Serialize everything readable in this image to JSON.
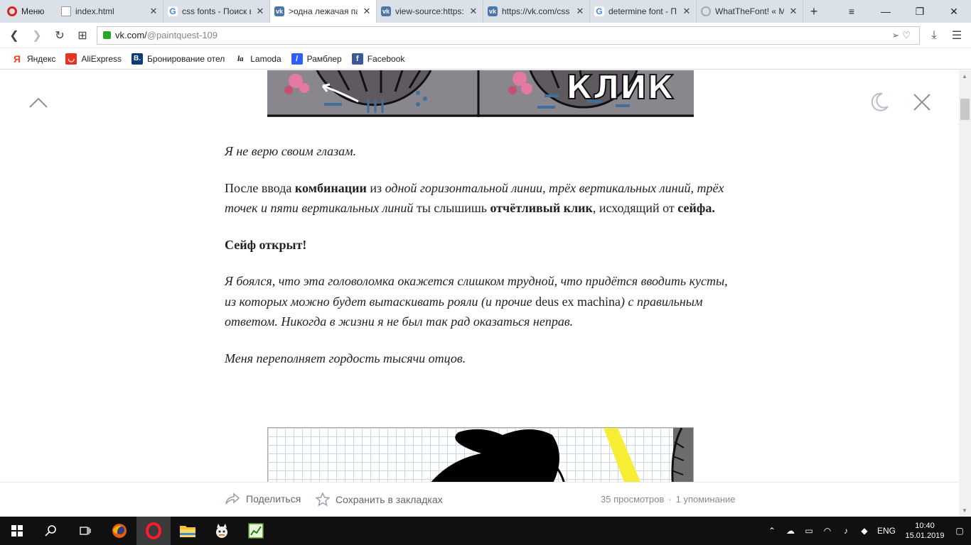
{
  "browser": {
    "menu_label": "Меню",
    "tabs": [
      {
        "title": "index.html",
        "icon": "document-icon"
      },
      {
        "title": "css fonts - Поиск в",
        "icon": "google-icon"
      },
      {
        "title": ">одна лежачая па",
        "icon": "vk-icon",
        "active": true
      },
      {
        "title": "view-source:https:/",
        "icon": "vk-icon"
      },
      {
        "title": "https://vk.com/css",
        "icon": "vk-icon"
      },
      {
        "title": "determine font - П",
        "icon": "google-icon"
      },
      {
        "title": "WhatTheFont! « M",
        "icon": "loading-icon"
      }
    ],
    "new_tab_label": "+",
    "url_host": "vk.com/",
    "url_path": "@paintquest-109",
    "bookmarks": [
      {
        "label": "Яндекс",
        "icon": "yandex-icon",
        "color": "#fc3f1d",
        "glyph": "Я"
      },
      {
        "label": "AliExpress",
        "icon": "aliexpress-icon",
        "color": "#e43225",
        "glyph": "◡"
      },
      {
        "label": "Бронирование отел",
        "icon": "booking-icon",
        "color": "#0c3b7c",
        "glyph": "B."
      },
      {
        "label": "Lamoda",
        "icon": "lamoda-icon",
        "color": "#111111",
        "glyph": "la"
      },
      {
        "label": "Рамблер",
        "icon": "rambler-icon",
        "color": "#315efb",
        "glyph": "/"
      },
      {
        "label": "Facebook",
        "icon": "facebook-icon",
        "color": "#3b5998",
        "glyph": "f"
      }
    ]
  },
  "article": {
    "p1": "Я не верю своим глазам.",
    "p2": {
      "a": "После ввода ",
      "b": "комбинации",
      "c": " из ",
      "d": "одной горизонтальной линии, трёх вертикальных линий, трёх точек и пяти вертикальных линий",
      "e": " ты слышишь ",
      "f": "отчётливый клик",
      "g": ", исходящий от ",
      "h": "сейфа."
    },
    "p3": "Сейф открыт!",
    "p4": {
      "a": "Я боялся, что эта головоломка окажется слишком трудной, что придётся вводить кусты, из которых можно будет вытаскивать рояли (и прочие ",
      "b": "deus ex machina",
      "c": ") с правильным ответом. Никогда в жизни я не был так рад оказаться неправ."
    },
    "p5": "Меня переполняет гордость тысячи отцов.",
    "comic_text": "КЛИК"
  },
  "footer": {
    "share_label": "Поделиться",
    "bookmark_label": "Сохранить в закладках",
    "views": "35 просмотров",
    "separator": "·",
    "mentions": "1 упоминание"
  },
  "taskbar": {
    "language": "ENG",
    "time": "10:40",
    "date": "15.01.2019"
  },
  "colors": {
    "accent": "#e0201b",
    "vk": "#4a76a8",
    "link_muted": "#818c99"
  }
}
